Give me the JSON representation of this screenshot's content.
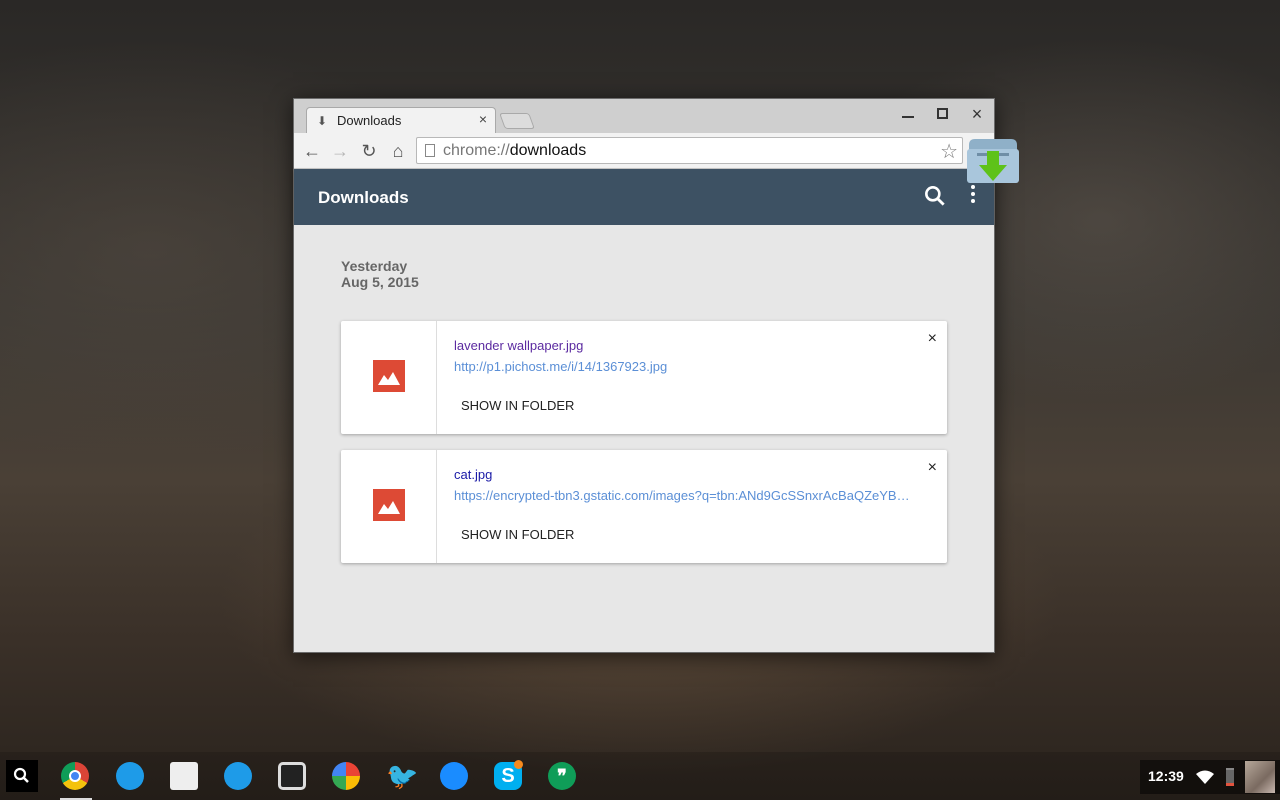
{
  "browser": {
    "tab": {
      "title": "Downloads",
      "icon": "download-arrow-icon",
      "close_label": "×"
    },
    "window_controls": {
      "minimize": "minimize-icon",
      "maximize": "maximize-icon",
      "close": "×"
    },
    "nav": {
      "back": "←",
      "forward": "→",
      "reload": "↻",
      "home": "⌂"
    },
    "omnibox": {
      "scheme": "chrome://",
      "host": "downloads",
      "star": "☆"
    }
  },
  "appbar": {
    "title": "Downloads",
    "search_icon": "search-icon",
    "menu_icon": "more-vert-icon"
  },
  "date_group": {
    "relative": "Yesterday",
    "date": "Aug 5, 2015"
  },
  "downloads": [
    {
      "file_name": "lavender wallpaper.jpg",
      "file_name_color": "#5b2aa0",
      "url": "http://p1.pichost.me/i/14/1367923.jpg",
      "action": "SHOW IN FOLDER",
      "remove": "×",
      "icon": "image-icon"
    },
    {
      "file_name": "cat.jpg",
      "file_name_color": "#1a1aa6",
      "url": "https://encrypted-tbn3.gstatic.com/images?q=tbn:ANd9GcSSnxrAcBaQZeYB…",
      "action": "SHOW IN FOLDER",
      "remove": "×",
      "icon": "image-icon"
    }
  ],
  "shelf": {
    "apps": [
      "Chrome",
      "Files",
      "Web Store",
      "Camera",
      "Camera App",
      "Photos",
      "Twitter",
      "Messenger",
      "Skype",
      "Hangouts"
    ],
    "clock": "12:39"
  },
  "colors": {
    "appbar": "#3d5163",
    "image_icon": "#dd4a35",
    "url": "#5b8fd6"
  }
}
